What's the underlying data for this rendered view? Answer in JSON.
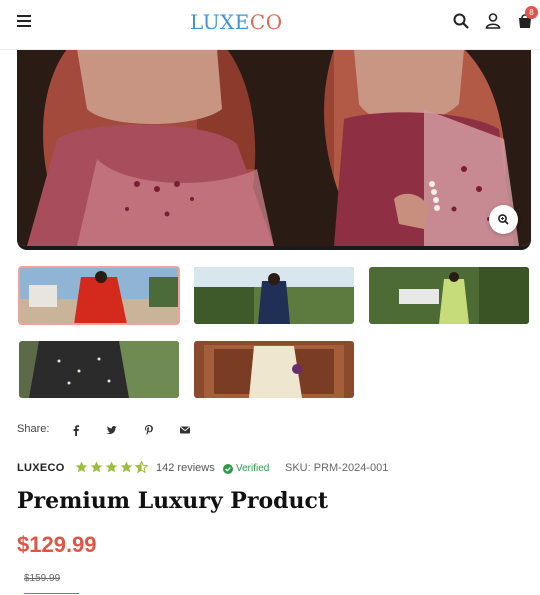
{
  "header": {
    "logo_part1": "LUXE",
    "logo_part2": "CO",
    "cart_count": "8",
    "logo_colors": {
      "part1": "#3f93d8",
      "part2": "#e06b52"
    }
  },
  "gallery": {
    "images": [
      "Woman in pink embroidered saree",
      "Woman in pink embroidered saree, close view"
    ],
    "thumbnails": [
      {
        "description": "Red saree, lion statue background",
        "active": true
      },
      {
        "description": "Navy blue outfit, garden background",
        "active": false
      },
      {
        "description": "Light green saree, garden background",
        "active": false
      },
      {
        "description": "Black embellished outfit, outdoors",
        "active": false
      },
      {
        "description": "Cream saree, wooden door background",
        "active": false
      }
    ]
  },
  "share": {
    "label": "Share:",
    "icons": [
      "facebook-icon",
      "twitter-icon",
      "pinterest-icon",
      "email-icon"
    ]
  },
  "product": {
    "brand": "LUXECO",
    "rating": 4.5,
    "reviews": "142 reviews",
    "verified": "Verified",
    "sku": "SKU: PRM-2024-001",
    "title": "Premium Luxury Product",
    "price": "$129.99",
    "old_price": "$159.99",
    "accent_color": "#e25546"
  }
}
